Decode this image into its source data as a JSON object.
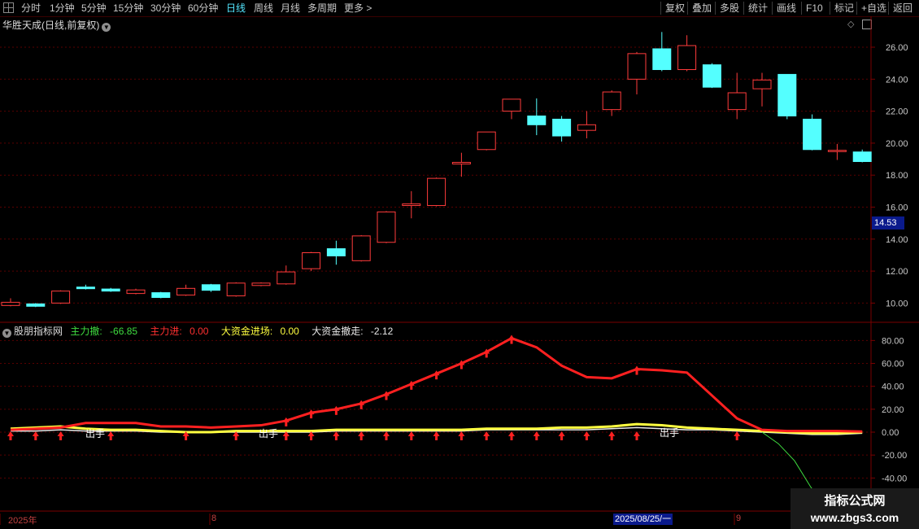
{
  "toolbar": {
    "periods": [
      "分时",
      "1分钟",
      "5分钟",
      "15分钟",
      "30分钟",
      "60分钟",
      "日线",
      "周线",
      "月线",
      "多周期",
      "更多 >"
    ],
    "active_period": "日线",
    "right_buttons": [
      "复权",
      "叠加",
      "多股",
      "统计",
      "画线",
      "F10",
      "标记",
      "+自选",
      "返回"
    ]
  },
  "main_chart": {
    "title": "华胜天成(日线,前复权)",
    "current_price_tag": "14.53",
    "y_ticks": [
      "26.00",
      "24.00",
      "22.00",
      "20.00",
      "18.00",
      "16.00",
      "14.00",
      "12.00",
      "10.00"
    ],
    "candles": [
      {
        "o": 9.85,
        "c": 10.05,
        "h": 10.3,
        "l": 9.8
      },
      {
        "o": 9.95,
        "c": 9.8,
        "h": 10.0,
        "l": 9.75
      },
      {
        "o": 10.0,
        "c": 10.75,
        "h": 10.8,
        "l": 9.95
      },
      {
        "o": 11.0,
        "c": 10.9,
        "h": 11.15,
        "l": 10.85
      },
      {
        "o": 10.88,
        "c": 10.75,
        "h": 10.95,
        "l": 10.7
      },
      {
        "o": 10.6,
        "c": 10.82,
        "h": 10.9,
        "l": 10.55
      },
      {
        "o": 10.65,
        "c": 10.35,
        "h": 10.7,
        "l": 10.3
      },
      {
        "o": 10.5,
        "c": 10.92,
        "h": 11.15,
        "l": 10.45
      },
      {
        "o": 11.15,
        "c": 10.8,
        "h": 11.2,
        "l": 10.7
      },
      {
        "o": 10.45,
        "c": 11.25,
        "h": 11.3,
        "l": 10.4
      },
      {
        "o": 11.1,
        "c": 11.25,
        "h": 11.3,
        "l": 11.05
      },
      {
        "o": 11.2,
        "c": 11.95,
        "h": 12.35,
        "l": 11.15
      },
      {
        "o": 12.15,
        "c": 13.15,
        "h": 13.2,
        "l": 12.0
      },
      {
        "o": 13.4,
        "c": 12.95,
        "h": 13.9,
        "l": 12.4
      },
      {
        "o": 12.65,
        "c": 14.2,
        "h": 14.25,
        "l": 12.6
      },
      {
        "o": 13.8,
        "c": 15.7,
        "h": 15.75,
        "l": 13.75
      },
      {
        "o": 16.1,
        "c": 16.2,
        "h": 17.0,
        "l": 15.3
      },
      {
        "o": 16.1,
        "c": 17.8,
        "h": 17.85,
        "l": 16.05
      },
      {
        "o": 18.7,
        "c": 18.8,
        "h": 19.4,
        "l": 17.9
      },
      {
        "o": 19.6,
        "c": 20.7,
        "h": 20.7,
        "l": 19.55
      },
      {
        "o": 22.0,
        "c": 22.75,
        "h": 22.75,
        "l": 21.5
      },
      {
        "o": 21.7,
        "c": 21.15,
        "h": 22.8,
        "l": 20.5
      },
      {
        "o": 21.5,
        "c": 20.45,
        "h": 21.7,
        "l": 20.1
      },
      {
        "o": 20.8,
        "c": 21.15,
        "h": 22.0,
        "l": 20.3
      },
      {
        "o": 22.1,
        "c": 23.2,
        "h": 23.3,
        "l": 21.7
      },
      {
        "o": 24.0,
        "c": 25.6,
        "h": 25.7,
        "l": 23.05
      },
      {
        "o": 25.9,
        "c": 24.6,
        "h": 26.95,
        "l": 24.5
      },
      {
        "o": 24.6,
        "c": 26.1,
        "h": 26.75,
        "l": 24.5
      },
      {
        "o": 24.9,
        "c": 23.5,
        "h": 25.0,
        "l": 23.45
      },
      {
        "o": 22.1,
        "c": 23.15,
        "h": 24.4,
        "l": 21.5
      },
      {
        "o": 23.4,
        "c": 23.95,
        "h": 24.4,
        "l": 22.3
      },
      {
        "o": 24.3,
        "c": 21.7,
        "h": 24.3,
        "l": 21.5
      },
      {
        "o": 21.5,
        "c": 19.6,
        "h": 21.8,
        "l": 19.55
      },
      {
        "o": 19.55,
        "c": 19.55,
        "h": 19.95,
        "l": 18.95
      },
      {
        "o": 19.45,
        "c": 18.85,
        "h": 19.6,
        "l": 18.8
      }
    ]
  },
  "indicator": {
    "name": "股朋指标网",
    "legend": [
      {
        "label": "主力撤:",
        "value": "-66.85",
        "color": "#3fdc3f"
      },
      {
        "label": "主力进:",
        "value": "0.00",
        "color": "#ff3030"
      },
      {
        "label": "大资金进场:",
        "value": "0.00",
        "color": "#ffff40"
      },
      {
        "label": "大资金撤走:",
        "value": "-2.12",
        "color": "#e8e8e8"
      }
    ],
    "y_ticks": [
      "80.00",
      "60.00",
      "40.00",
      "20.00",
      "0.00",
      "-20.00",
      "-40.00"
    ],
    "annotations": [
      "出手",
      "出手",
      "出手"
    ],
    "red_line": [
      2,
      3,
      4,
      8,
      8,
      8,
      5,
      5,
      4,
      5,
      6,
      10,
      17,
      20,
      25,
      33,
      42,
      51,
      60,
      70,
      82,
      74,
      58,
      48,
      47,
      55,
      54,
      52,
      32,
      12,
      2,
      1,
      1,
      1,
      0.5
    ],
    "yellow_line": [
      3,
      4,
      5,
      3,
      2,
      2,
      1,
      0,
      0,
      1,
      1,
      1,
      1,
      2,
      2,
      2,
      2,
      2,
      2,
      3,
      3,
      3,
      4,
      4,
      5,
      7,
      6,
      4,
      3,
      2,
      1,
      0,
      -1,
      -1,
      0
    ],
    "white_line": [
      1,
      1,
      2,
      1,
      1,
      1,
      0,
      0,
      0,
      0,
      0,
      0,
      0,
      1,
      1,
      1,
      1,
      1,
      1,
      2,
      2,
      2,
      2,
      2,
      3,
      4,
      3,
      2,
      2,
      1,
      0,
      -1,
      -2,
      -2,
      -1
    ],
    "green_line": [
      0,
      -10,
      -25,
      -48,
      -66.85
    ],
    "arrow_candles": [
      0,
      1,
      2,
      4,
      7,
      9,
      11,
      11,
      12,
      13,
      14,
      15,
      16,
      17,
      18,
      19,
      20,
      21,
      22,
      23,
      24,
      25,
      29
    ],
    "arrow_candles_up": [
      11,
      12,
      13,
      14,
      15,
      16,
      17,
      18,
      19,
      20,
      25
    ]
  },
  "axis": {
    "labels": [
      "2025年",
      "8",
      "9"
    ],
    "date_highlight": "2025/08/25/一"
  },
  "watermark": {
    "line1": "指标公式网",
    "line2": "www.zbgs3.com"
  },
  "colors": {
    "up": "#ff3b3b",
    "down": "#54ffff",
    "grid": "#5a0000",
    "axis_text": "#c8c8c8"
  }
}
